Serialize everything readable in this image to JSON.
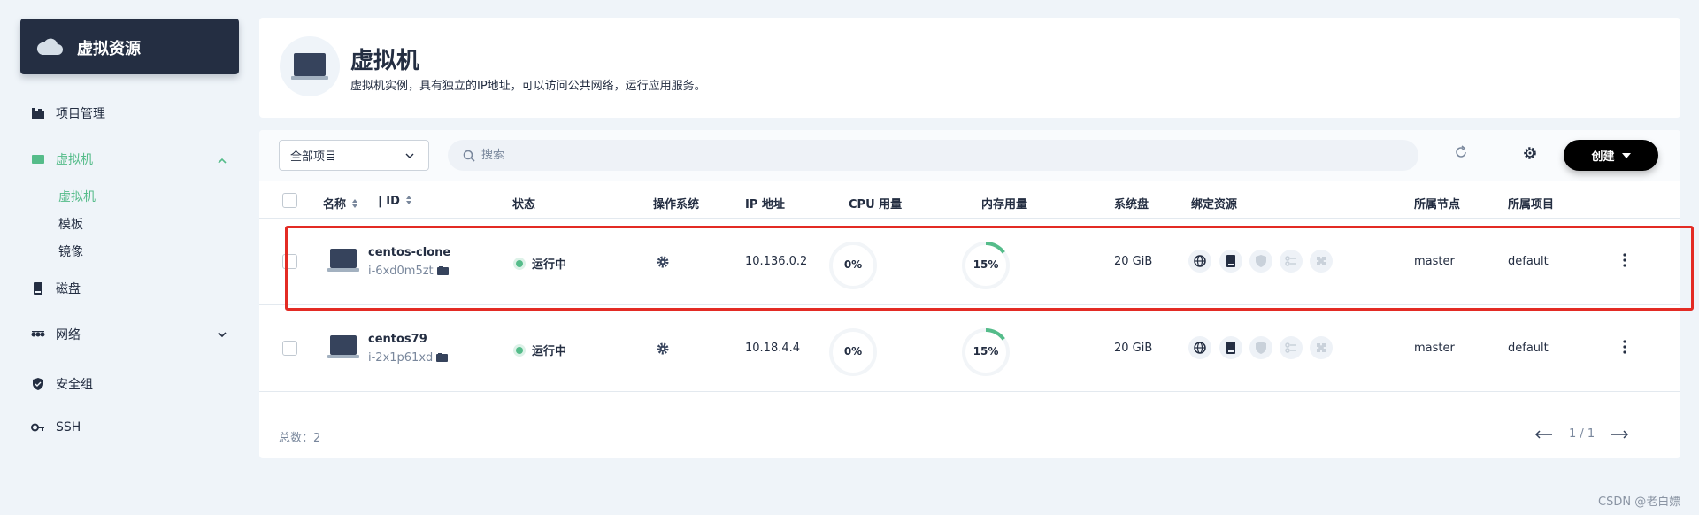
{
  "sidebar": {
    "brand_title": "虚拟资源",
    "items": [
      {
        "label": "项目管理",
        "icon": "project-icon"
      },
      {
        "label": "虚拟机",
        "icon": "vm-icon",
        "active": true,
        "expanded": true
      },
      {
        "label": "磁盘",
        "icon": "disk-icon"
      },
      {
        "label": "网络",
        "icon": "network-icon",
        "collapsed": true
      },
      {
        "label": "安全组",
        "icon": "shield-icon"
      },
      {
        "label": "SSH",
        "icon": "key-icon"
      }
    ],
    "sub_items": [
      {
        "label": "虚拟机",
        "active": true
      },
      {
        "label": "模板"
      },
      {
        "label": "镜像"
      }
    ]
  },
  "header": {
    "title": "虚拟机",
    "description": "虚拟机实例，具有独立的IP地址，可以访问公共网络，运行应用服务。"
  },
  "toolbar": {
    "project_select": "全部项目",
    "search_placeholder": "搜索",
    "create_label": "创建"
  },
  "table": {
    "columns": [
      "名称",
      "| ID",
      "状态",
      "操作系统",
      "IP 地址",
      "CPU 用量",
      "内存用量",
      "系统盘",
      "绑定资源",
      "所属节点",
      "所属项目"
    ],
    "rows": [
      {
        "name": "centos-clone",
        "id": "i-6xd0m5zt",
        "status": "运行中",
        "os": "gear-icon",
        "ip": "10.136.0.2",
        "cpu": "0%",
        "cpu_value": 0,
        "mem": "15%",
        "mem_value": 15,
        "disk": "20 GiB",
        "node": "master",
        "project": "default"
      },
      {
        "name": "centos79",
        "id": "i-2x1p61xd",
        "status": "运行中",
        "os": "gear-icon",
        "ip": "10.18.4.4",
        "cpu": "0%",
        "cpu_value": 0,
        "mem": "15%",
        "mem_value": 15,
        "disk": "20 GiB",
        "node": "master",
        "project": "default"
      }
    ],
    "bound_resource_icons": [
      "globe-icon",
      "disk-icon",
      "shield-icon",
      "key-icon",
      "puzzle-icon"
    ]
  },
  "footer": {
    "total": "总数：2",
    "page": "1 / 1"
  },
  "colors": {
    "accent": "#55bc8a",
    "dark": "#242e42",
    "highlight": "#e32b24"
  },
  "watermark": "CSDN @老白嫖"
}
